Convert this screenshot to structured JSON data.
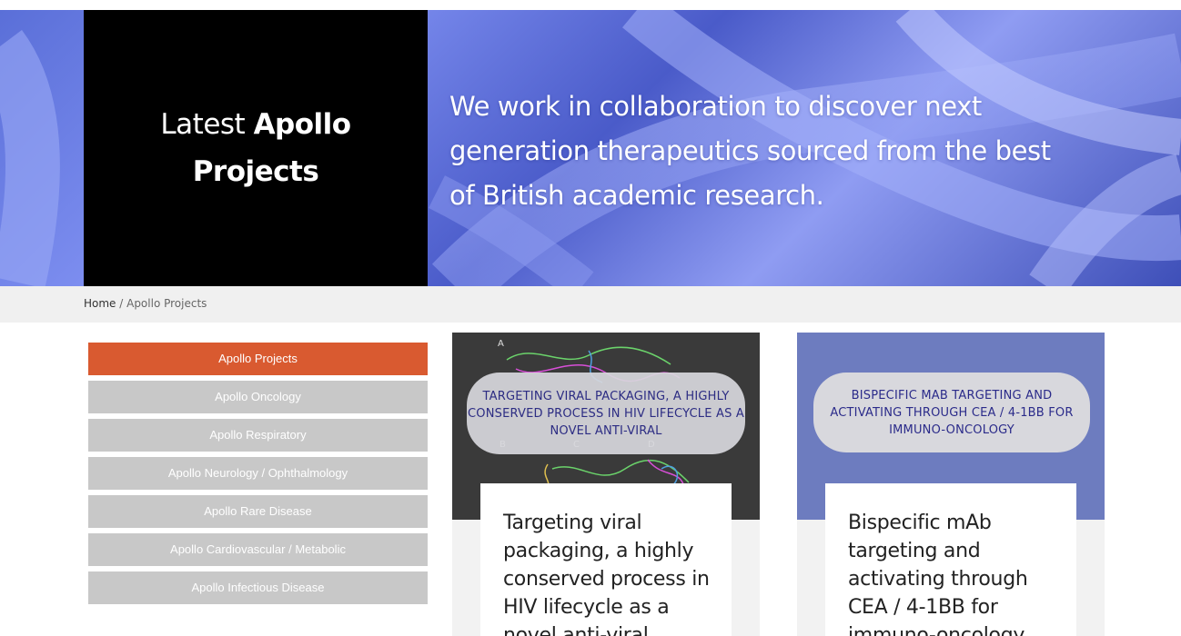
{
  "hero": {
    "title_light": "Latest ",
    "title_bold_1": "Apollo",
    "title_bold_2": "Projects",
    "tagline": "We work in collaboration to discover next generation therapeutics sourced from the best of British academic research."
  },
  "breadcrumb": {
    "home": "Home",
    "separator": " / ",
    "current": "Apollo Projects"
  },
  "sidebar": {
    "items": [
      {
        "label": "Apollo Projects",
        "active": true
      },
      {
        "label": "Apollo Oncology"
      },
      {
        "label": "Apollo Respiratory"
      },
      {
        "label": "Apollo Neurology / Ophthalmology"
      },
      {
        "label": "Apollo Rare Disease"
      },
      {
        "label": "Apollo Cardiovascular / Metabolic"
      },
      {
        "label": "Apollo Infectious Disease"
      }
    ]
  },
  "cards": [
    {
      "image_text": "TARGETING VIRAL PACKAGING, A HIGHLY CONSERVED PROCESS IN HIV LIFECYCLE AS A NOVEL ANTI-VIRAL",
      "figure_labels": [
        "A",
        "B",
        "C",
        "D"
      ],
      "title": "Targeting viral packaging, a highly conserved process in HIV lifecycle as a novel anti-viral"
    },
    {
      "image_text": "BISPECIFIC MAB TARGETING AND ACTIVATING THROUGH CEA / 4-1BB FOR IMMUNO-ONCOLOGY",
      "title": "Bispecific mAb targeting and activating through CEA / 4-1BB for immuno-oncology"
    }
  ],
  "colors": {
    "accent": "#d95a30",
    "menu_inactive": "#c8c8c8",
    "hero_blue": "#5a6fd8",
    "card2_bg": "#6d7cbf"
  }
}
